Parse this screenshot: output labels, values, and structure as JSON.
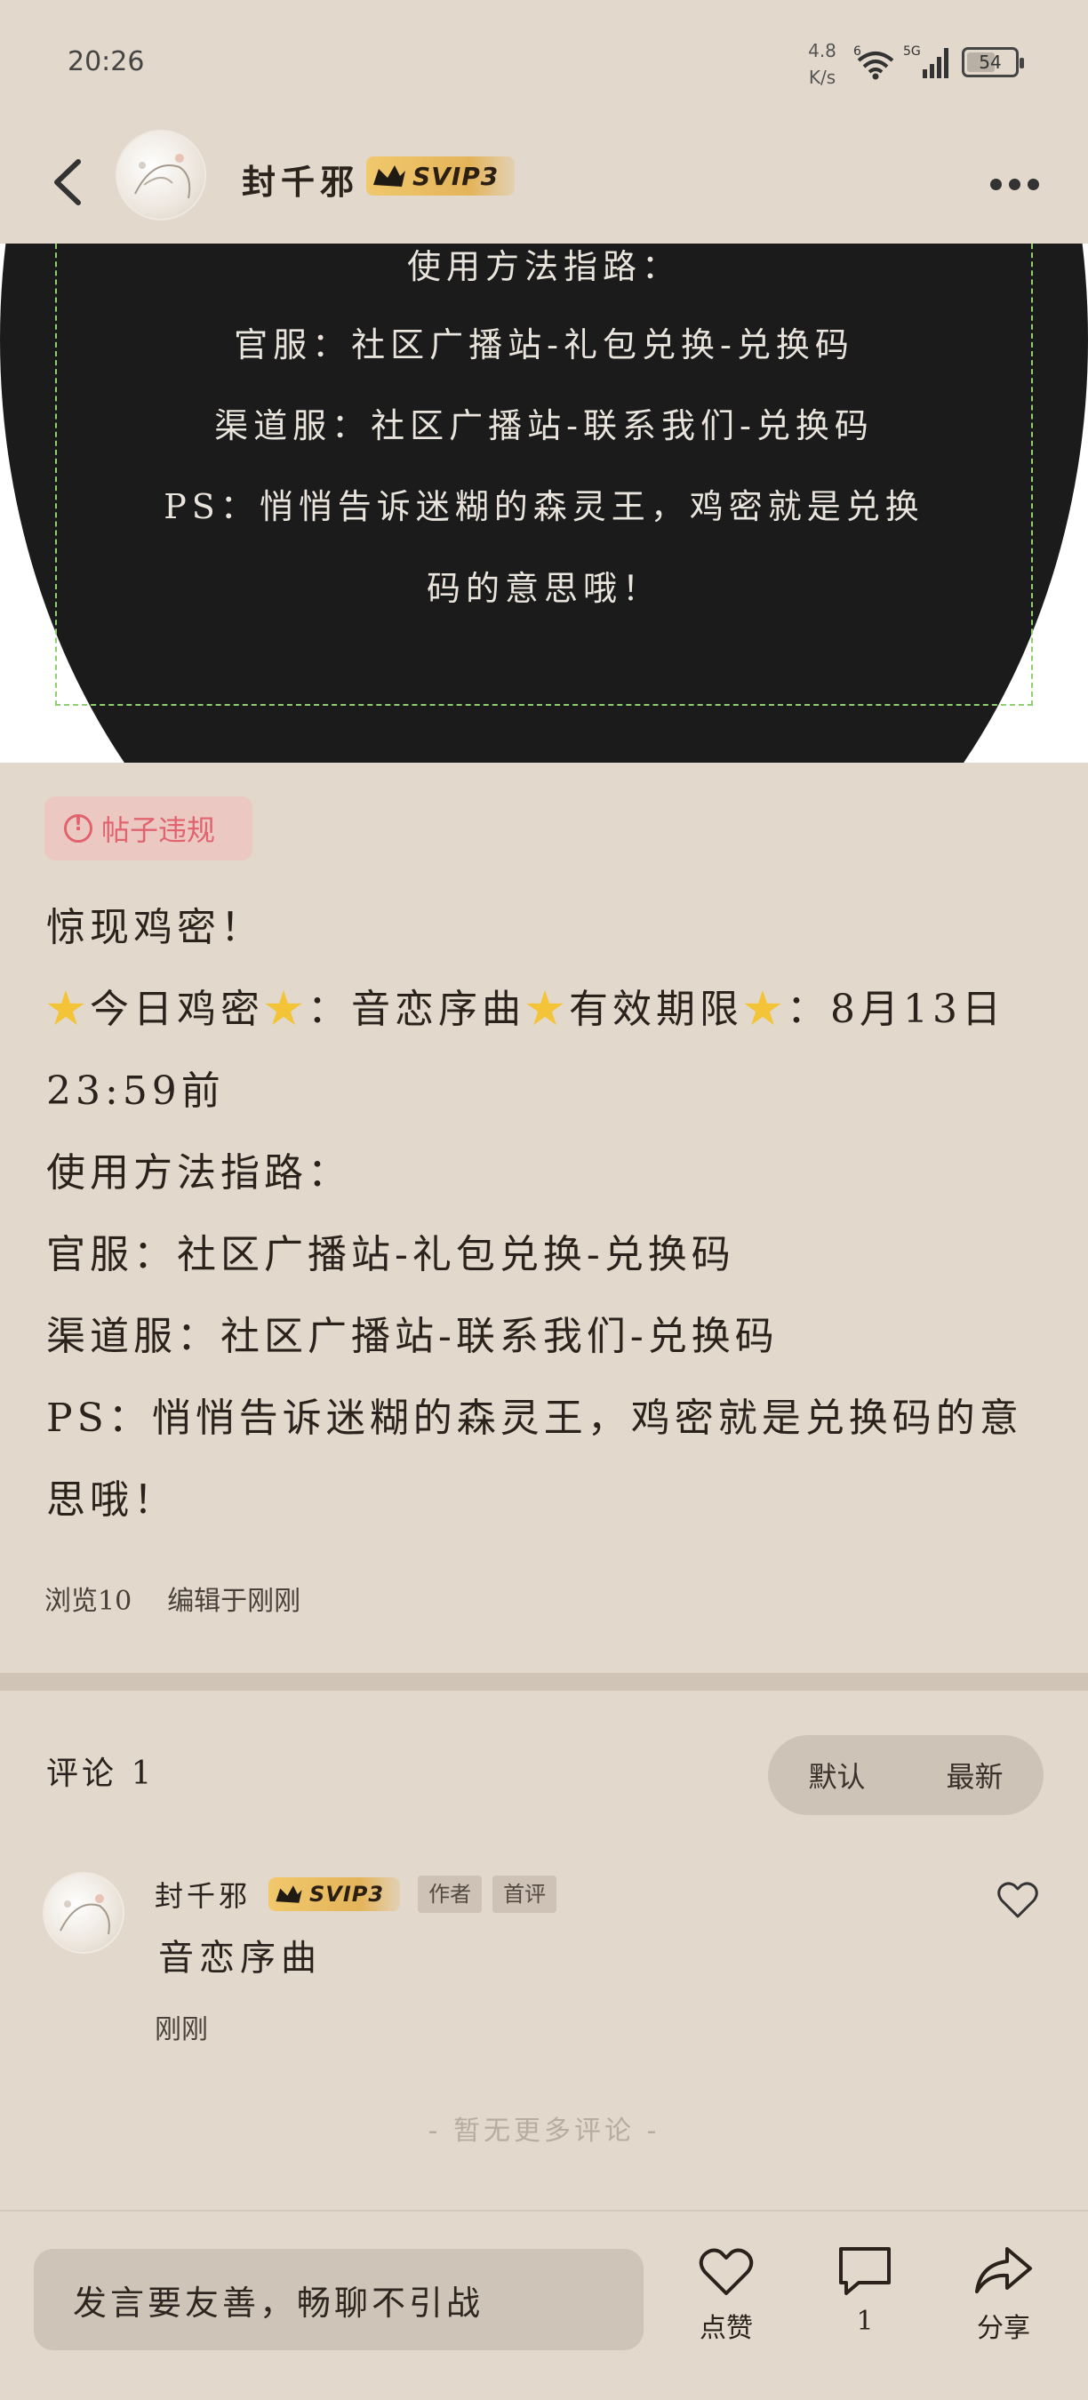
{
  "status_bar": {
    "time": "20:26",
    "net_speed_value": "4.8",
    "net_speed_unit": "K/s",
    "wifi_label": "6",
    "signal_label": "5G",
    "battery": "54"
  },
  "header": {
    "username": "封千邪",
    "vip_label": "SVIP3"
  },
  "image_text": [
    "使用方法指路：",
    "官服：社区广播站-礼包兑换-兑换码",
    "渠道服：社区广播站-联系我们-兑换码",
    "PS：悄悄告诉迷糊的森灵王，鸡密就是兑换",
    "码的意思哦！"
  ],
  "post": {
    "violation_label": "帖子违规",
    "title": "惊现鸡密！",
    "line2_a": "今日鸡密",
    "line2_b": "：音恋序曲",
    "line2_c": "有效期限",
    "line2_d": "：8月13日23:59前",
    "line3": "使用方法指路：",
    "line4": "官服：社区广播站-礼包兑换-兑换码",
    "line5": "渠道服：社区广播站-联系我们-兑换码",
    "line6": "PS：悄悄告诉迷糊的森灵王，鸡密就是兑换码的意思哦！",
    "views": "浏览10",
    "edited": "编辑于刚刚"
  },
  "comments": {
    "title": "评论 1",
    "sort_default": "默认",
    "sort_latest": "最新",
    "items": [
      {
        "name": "封千邪",
        "vip": "SVIP3",
        "tag_author": "作者",
        "tag_first": "首评",
        "text": "音恋序曲",
        "time": "刚刚"
      }
    ],
    "no_more": "- 暂无更多评论 -"
  },
  "bottom_bar": {
    "input_placeholder": "发言要友善，畅聊不引战",
    "like_label": "点赞",
    "comment_count": "1",
    "share_label": "分享"
  },
  "colors": {
    "background": "#e2d8cb",
    "violation": "#e0636e",
    "vip_gold": "#e4b45a",
    "image_bg": "#1b1b1b",
    "dash_green": "#8fcf6f"
  }
}
